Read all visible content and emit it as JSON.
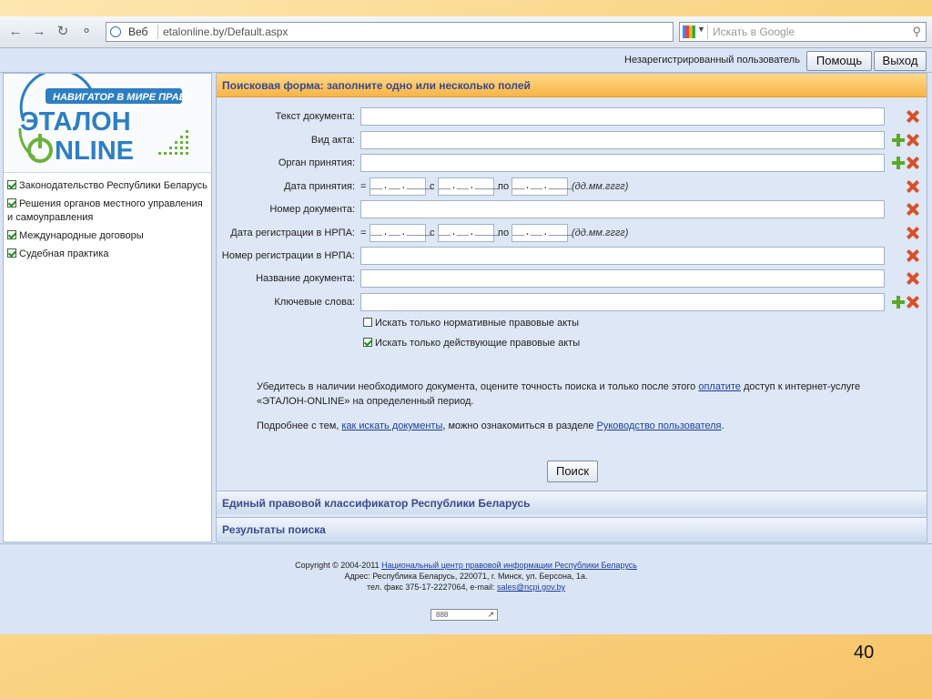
{
  "browser": {
    "nav_icons": [
      "back-arrow-icon",
      "forward-arrow-icon",
      "reload-icon",
      "key-icon"
    ],
    "address_mode": "Веб",
    "url": "etalonline.by/Default.aspx",
    "search_placeholder": "Искать в Google"
  },
  "header": {
    "user_status": "Незарегистрированный пользователь",
    "help_label": "Помощь",
    "logout_label": "Выход"
  },
  "logo": {
    "tagline": "НАВИГАТОР В МИРЕ ПРАВА",
    "line1": "ЭТАЛОН",
    "line2": "NLINE"
  },
  "sidebar": {
    "categories": [
      {
        "label": "Законодательство Республики Беларусь",
        "checked": true
      },
      {
        "label": "Решения органов местного управления и самоуправления",
        "checked": true
      },
      {
        "label": "Международные договоры",
        "checked": true
      },
      {
        "label": "Судебная практика",
        "checked": true
      }
    ]
  },
  "form": {
    "title": "Поисковая форма: заполните одно или несколько полей",
    "fields": {
      "doc_text": "Текст документа:",
      "act_type": "Вид акта:",
      "organ": "Орган принятия:",
      "adoption_date": "Дата принятия:",
      "doc_number": "Номер документа:",
      "reg_date": "Дата регистрации в НРПА:",
      "reg_number": "Номер регистрации в НРПА:",
      "doc_name": "Название документа:",
      "keywords": "Ключевые слова:"
    },
    "date_placeholder": "__.__.____",
    "eq": "=",
    "from": "с",
    "to": "по",
    "date_format": "(дд.мм.гггг)",
    "options": {
      "normative_only": {
        "label": "Искать только нормативные правовые акты",
        "checked": false
      },
      "active_only": {
        "label": "Искать только действующие правовые акты",
        "checked": true
      }
    },
    "note1": {
      "before": "Убедитесь в наличии необходимого документа, оцените точность поиска и только после этого ",
      "link": "оплатите",
      "after": " доступ к интернет-услуге «ЭТАЛОН-ONLINE» на определенный период."
    },
    "note2": {
      "before": "Подробнее с тем, ",
      "link1": "как искать документы",
      "middle": ", можно ознакомиться в разделе ",
      "link2": "Руководство пользователя",
      "after": "."
    },
    "search_label": "Поиск"
  },
  "sections": {
    "classifier": "Единый правовой классификатор Республики Беларусь",
    "results": "Результаты поиска"
  },
  "footer": {
    "copyright": "Copyright © 2004-2011 ",
    "org_link": "Национальный центр правовой информации Республики Беларусь",
    "address": "Адрес: Республика Беларусь, 220071, г. Минск, ул. Берсона, 1а.",
    "contacts": "тел. факс 375-17-2227064, e-mail: ",
    "email": "sales@ncpi.gov.by",
    "counter": "888"
  },
  "slide_number": "40",
  "colors": {
    "header_orange": "#f7b547",
    "title_blue": "#3b4a8c",
    "page_blue": "#d9e4f4",
    "remove_red": "#d8502a",
    "add_green": "#5aa82a"
  }
}
